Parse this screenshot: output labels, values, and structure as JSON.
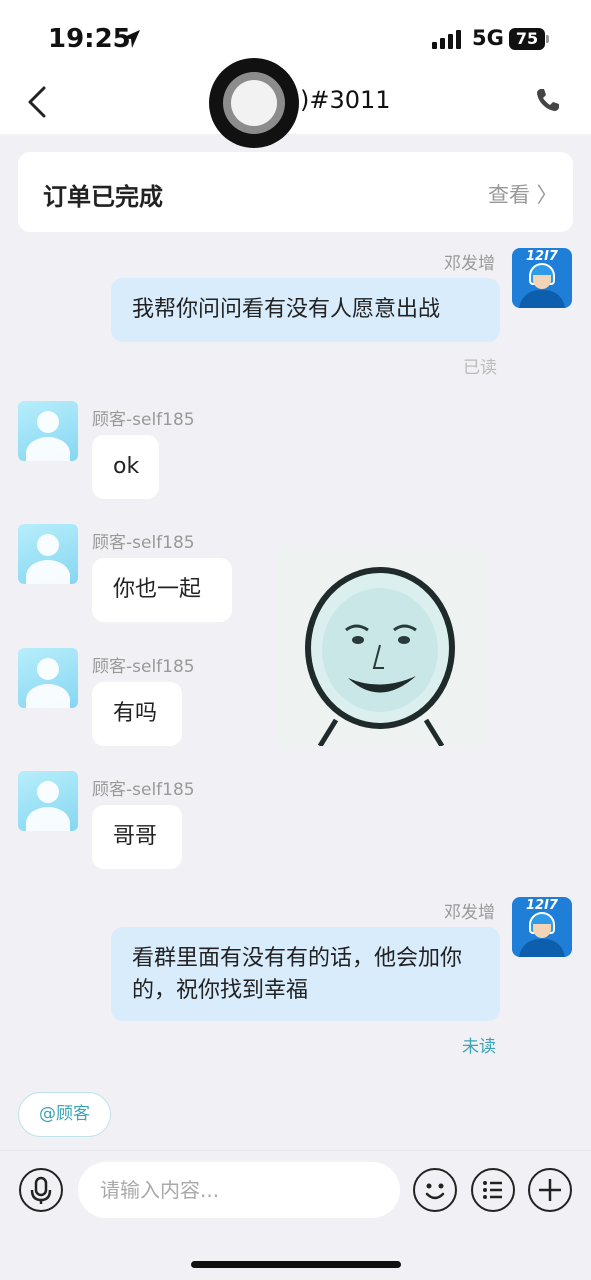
{
  "status_bar": {
    "time": "19:25",
    "network": "5G",
    "battery": "75"
  },
  "nav": {
    "title": ")#3011",
    "back_icon": "chevron-left-icon",
    "call_icon": "phone-icon"
  },
  "order_card": {
    "status": "订单已完成",
    "view_label": "查看 〉"
  },
  "messages": [
    {
      "sender": "邓发增",
      "side": "right",
      "text": "我帮你问问看有没有人愿意出战",
      "read_status": "已读"
    },
    {
      "sender": "顾客-self185",
      "side": "left",
      "text": "ok"
    },
    {
      "sender": "顾客-self185",
      "side": "left",
      "text": "你也一起"
    },
    {
      "sender": "顾客-self185",
      "side": "left",
      "text": "有吗"
    },
    {
      "sender": "顾客-self185",
      "side": "left",
      "text": "哥哥"
    },
    {
      "sender": "邓发增",
      "side": "right",
      "text": "看群里面有没有有的话，他会加你的，祝你找到幸福",
      "read_status": "未读"
    }
  ],
  "agent_avatar_logo": "12I7",
  "sticker": {
    "type": "meme-face-sticker"
  },
  "mention_chip": "@顾客",
  "input_bar": {
    "placeholder": "请输入内容...",
    "icons": [
      "microphone-icon",
      "emoji-icon",
      "list-icon",
      "plus-icon"
    ]
  },
  "colors": {
    "accent": "#3aa3b5",
    "bubble_right": "#d9ecfc",
    "unread": "#3aa3b5",
    "read": "#bbbbbb"
  }
}
